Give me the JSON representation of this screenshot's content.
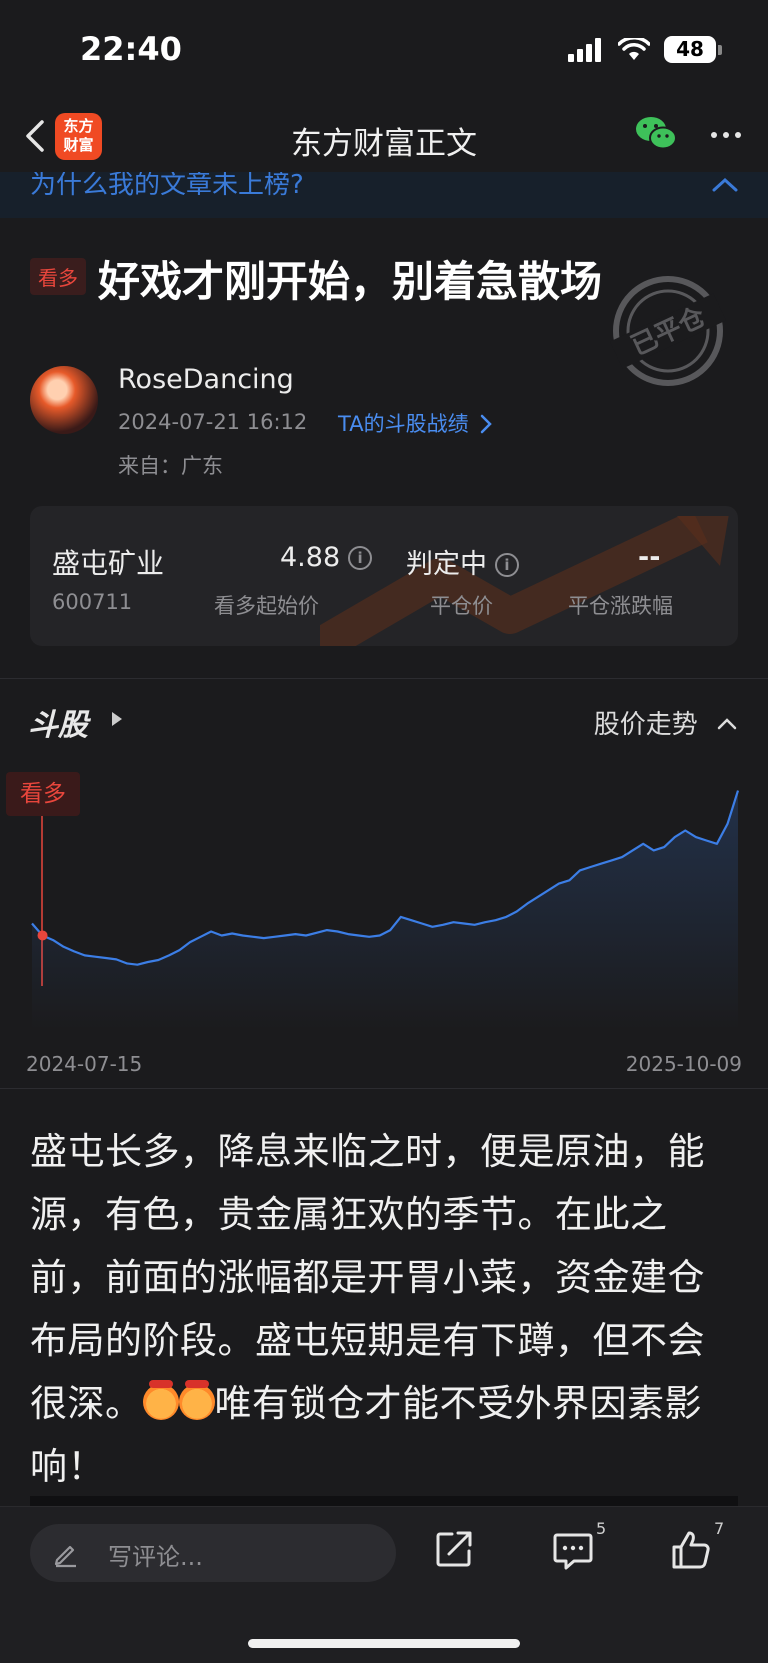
{
  "status": {
    "time": "22:40",
    "battery": "48"
  },
  "nav": {
    "title": "东方财富正文",
    "logo_line1": "东方",
    "logo_line2": "财富"
  },
  "promo": {
    "text": "为什么我的文章未上榜?"
  },
  "article": {
    "tag": "看多",
    "title": "好戏才刚开始，别着急散场",
    "stamp": "已平仓",
    "author": "RoseDancing",
    "date": "2024-07-21 16:12",
    "record_link": "TA的斗股战绩",
    "origin": "来自：广东",
    "body": "盛屯长多，降息来临之时，便是原油，能源，有色，贵金属狂欢的季节。在此之前，前面的涨幅都是开胃小菜，资金建仓布局的阶段。盛屯短期是有下蹲，但不会很深。",
    "body_tail": "唯有锁仓才能不受外界因素影响！"
  },
  "stock": {
    "name": "盛屯矿业",
    "code": "600711",
    "start_price": "4.88",
    "start_price_label": "看多起始价",
    "status": "判定中",
    "close_price_label": "平仓价",
    "change_value": "--",
    "change_label": "平仓涨跌幅"
  },
  "chart_header": {
    "logo": "斗股",
    "toggle": "股价走势"
  },
  "chart_data": {
    "type": "line",
    "marker_label": "看多",
    "x_start": "2024-07-15",
    "x_end": "2025-10-09",
    "line_color": "#3c7ee6",
    "series": [
      {
        "values": [
          4.9,
          4.72,
          4.65,
          4.55,
          4.48,
          4.42,
          4.4,
          4.38,
          4.36,
          4.3,
          4.28,
          4.32,
          4.35,
          4.42,
          4.5,
          4.62,
          4.7,
          4.78,
          4.72,
          4.75,
          4.72,
          4.7,
          4.68,
          4.7,
          4.72,
          4.74,
          4.72,
          4.76,
          4.8,
          4.78,
          4.74,
          4.72,
          4.7,
          4.72,
          4.8,
          5.0,
          4.95,
          4.9,
          4.85,
          4.88,
          4.92,
          4.9,
          4.88,
          4.92,
          4.95,
          5.0,
          5.08,
          5.2,
          5.3,
          5.4,
          5.5,
          5.55,
          5.7,
          5.75,
          5.8,
          5.85,
          5.9,
          6.0,
          6.1,
          6.0,
          6.05,
          6.2,
          6.3,
          6.2,
          6.15,
          6.1,
          6.4,
          6.9
        ]
      }
    ]
  },
  "bottom": {
    "placeholder": "写评论...",
    "comment_count": "5",
    "like_count": "7"
  },
  "colors": {
    "accent_red": "#e8463c",
    "link_blue": "#4a8df0",
    "logo_orange": "#f04a23",
    "background": "#1b1b1d"
  },
  "icons": [
    "back-chevron-icon",
    "wechat-icon",
    "more-dots-icon",
    "info-icon",
    "play-icon",
    "pencil-icon",
    "share-icon",
    "comment-icon",
    "thumbs-up-icon"
  ]
}
